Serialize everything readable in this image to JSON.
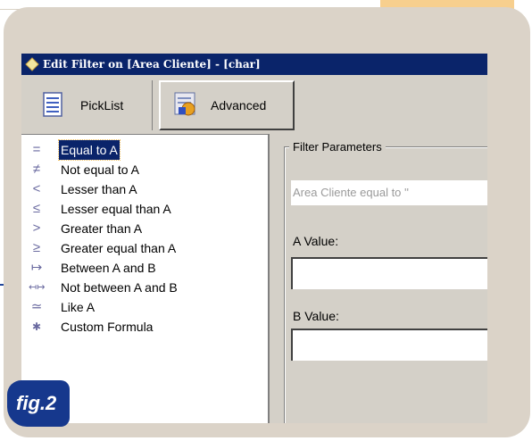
{
  "figure": {
    "label": "fig.2"
  },
  "window": {
    "title": "Edit Filter on [Area Cliente] - [char]"
  },
  "tabs": [
    {
      "label": "PickList",
      "icon": "list-icon",
      "active": false
    },
    {
      "label": "Advanced",
      "icon": "advanced-icon",
      "active": true
    }
  ],
  "operators": {
    "selected_index": 0,
    "items": [
      {
        "symbol": "=",
        "label": "Equal to A"
      },
      {
        "symbol": "≠",
        "label": "Not equal to A"
      },
      {
        "symbol": "<",
        "label": "Lesser than A"
      },
      {
        "symbol": "≤",
        "label": "Lesser equal than A"
      },
      {
        "symbol": ">",
        "label": "Greater than A"
      },
      {
        "symbol": "≥",
        "label": "Greater equal than A"
      },
      {
        "symbol": "↦",
        "label": "Between A and B"
      },
      {
        "symbol": "↤↦",
        "label": "Not between A and B"
      },
      {
        "symbol": "≃",
        "label": "Like A"
      },
      {
        "symbol": "✱",
        "label": "Custom Formula"
      }
    ]
  },
  "filter_parameters": {
    "legend": "Filter Parameters",
    "description": "Area Cliente equal to ''",
    "a_value_label": "A Value:",
    "a_value": "",
    "b_value_label": "B Value:",
    "b_value": ""
  },
  "colors": {
    "title_bar": "#0a246a",
    "selection": "#0a246a",
    "frame": "#dbd3c8",
    "fig_badge": "#16388d"
  }
}
